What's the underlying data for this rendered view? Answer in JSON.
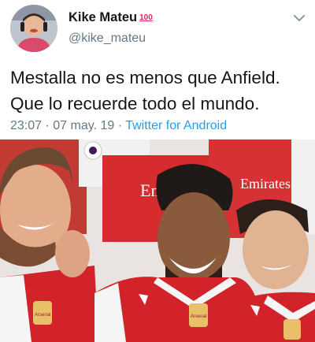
{
  "tweet": {
    "author": {
      "display_name": "Kike Mateu",
      "badge_emoji": "100",
      "handle": "@kike_mateu"
    },
    "text_line1": "Mestalla no es menos que Anfield.",
    "text_line2": "Que lo recuerde todo el mundo.",
    "time": "23:07",
    "date": "07 may. 19",
    "separator": "·",
    "source": "Twitter for Android"
  },
  "photo": {
    "shirt_text": "Emirates",
    "crest_text": "Arsenal"
  },
  "colors": {
    "link": "#1da1f2",
    "secondary_text": "#657786",
    "primary_text": "#14171a",
    "arsenal_red": "#d2232a",
    "badge_red": "#e0245e"
  },
  "icons": {
    "menu": "chevron-down-icon",
    "badge": "hundred-points-emoji"
  }
}
